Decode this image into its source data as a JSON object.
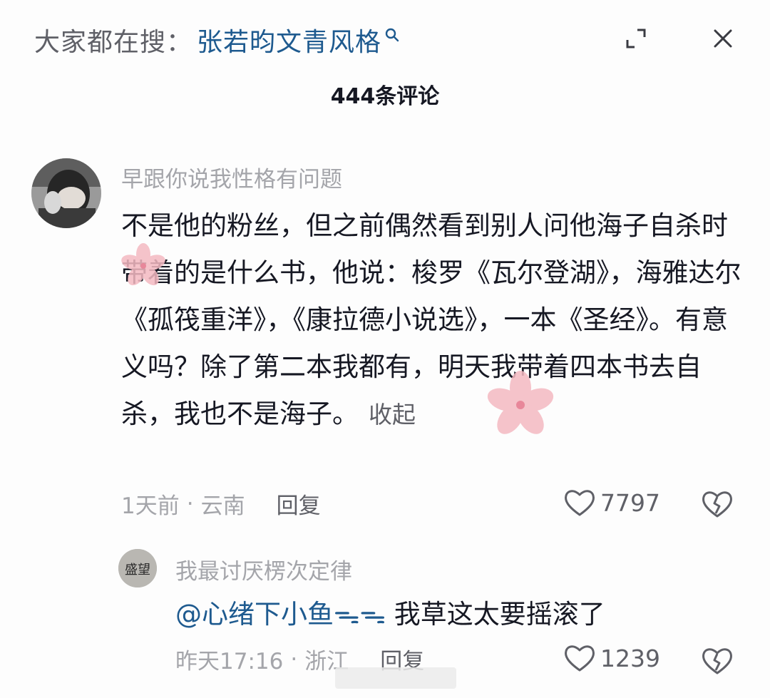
{
  "search": {
    "prefix": "大家都在搜：",
    "term": "张若昀文青风格"
  },
  "header": {
    "comment_count": "444条评论"
  },
  "comments": [
    {
      "username": "早跟你说我性格有问题",
      "text": "不是他的粉丝，但之前偶然看到别人问他海子自杀时带着的是什么书，他说：梭罗《瓦尔登湖》，海雅达尔《孤筏重洋》，《康拉德小说选》，一本《圣经》。有意义吗？除了第二本我都有，明天我带着四本书去自杀，我也不是海子。",
      "collapse_label": "收起",
      "time": "1天前",
      "location": "云南",
      "reply_label": "回复",
      "likes": "7797",
      "replies": [
        {
          "username": "我最讨厌楞次定律",
          "mention": "@心绪下小鱼ᯓᯓ",
          "text": "我草这太要摇滚了",
          "time": "昨天17:16",
          "location": "浙江",
          "reply_label": "回复",
          "likes": "1239",
          "avatar_text": "盛望"
        }
      ]
    }
  ],
  "colors": {
    "link": "#1e5a8f",
    "muted": "#a4a5aa",
    "text": "#161823",
    "blossom": "#f4b9c2"
  }
}
